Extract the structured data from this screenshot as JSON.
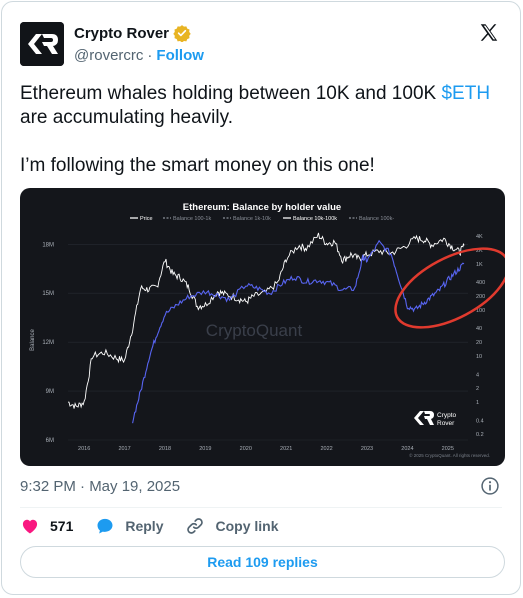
{
  "author": {
    "name": "Crypto Rover",
    "handle": "@rovercrc",
    "separator": "·",
    "follow_label": "Follow"
  },
  "tweet": {
    "text_before_cashtag": "Ethereum whales holding between 10K and 100K ",
    "cashtag": "$ETH",
    "text_after_cashtag": "are accumulating heavily.",
    "paragraph2": "I’m following the smart money on this one!"
  },
  "media": {
    "brand_logo_text": "Crypto\nRover",
    "watermark": "CryptoQuant"
  },
  "meta": {
    "timestamp": "9:32 PM · May 19, 2025"
  },
  "actions": {
    "like_count": "571",
    "reply_label": "Reply",
    "copy_link_label": "Copy link"
  },
  "read_replies_label": "Read 109 replies",
  "colors": {
    "accent": "#1d9bf0",
    "like": "#f91880",
    "chart_bg": "#14161b",
    "price_line": "#ffffff",
    "balance_line": "#5865f2",
    "highlight_circle": "#e03a2e"
  },
  "chart_data": {
    "type": "line",
    "title": "Ethereum: Balance by holder value",
    "legend": [
      {
        "name": "Price",
        "style": "solid",
        "color": "#ffffff"
      },
      {
        "name": "Balance 100-1k",
        "style": "dashed",
        "color": "#8a8f98"
      },
      {
        "name": "Balance 1k-10k",
        "style": "dashed",
        "color": "#8a8f98"
      },
      {
        "name": "Balance 10k-100k",
        "style": "solid",
        "color": "#ffffff"
      },
      {
        "name": "Balance 100k-",
        "style": "dashed",
        "color": "#8a8f98"
      }
    ],
    "legend_position": "top",
    "ylabel": "Balance",
    "left_ticks": [
      "18M",
      "15M",
      "12M",
      "9M",
      "6M"
    ],
    "right_ticks": [
      "4K",
      "2K",
      "1K",
      "400",
      "200",
      "100",
      "40",
      "20",
      "10",
      "4",
      "2",
      "1",
      "0.4",
      "0.2"
    ],
    "right_scale": "log",
    "x_ticks": [
      "2016",
      "2017",
      "2018",
      "2019",
      "2020",
      "2021",
      "2022",
      "2023",
      "2024",
      "2025"
    ],
    "x_range": [
      2015.6,
      2025.5
    ],
    "y_range_left": [
      6,
      19
    ],
    "footnote": "© 2025 CryptoQuant. All rights reserved.",
    "series": [
      {
        "name": "Price",
        "axis": "right",
        "x": [
          2015.6,
          2015.8,
          2016.0,
          2016.2,
          2016.5,
          2016.8,
          2017.0,
          2017.2,
          2017.4,
          2017.6,
          2017.8,
          2018.0,
          2018.2,
          2018.4,
          2018.6,
          2018.8,
          2019.0,
          2019.3,
          2019.5,
          2019.8,
          2020.0,
          2020.2,
          2020.5,
          2020.8,
          2021.0,
          2021.3,
          2021.5,
          2021.8,
          2022.0,
          2022.2,
          2022.4,
          2022.6,
          2022.8,
          2023.0,
          2023.3,
          2023.6,
          2023.9,
          2024.2,
          2024.4,
          2024.6,
          2024.9,
          2025.1,
          2025.3,
          2025.4
        ],
        "values": [
          1,
          0.8,
          1,
          10,
          12,
          9,
          8,
          40,
          300,
          280,
          320,
          1200,
          600,
          500,
          300,
          120,
          130,
          250,
          220,
          180,
          150,
          200,
          240,
          400,
          1300,
          2500,
          2200,
          4200,
          2800,
          3000,
          1200,
          1600,
          1300,
          1600,
          1900,
          1700,
          2300,
          3600,
          3400,
          2600,
          3500,
          2400,
          1800,
          2500
        ]
      },
      {
        "name": "Balance 10k-100k",
        "axis": "left",
        "x": [
          2017.2,
          2017.4,
          2017.6,
          2017.8,
          2018.0,
          2018.3,
          2018.6,
          2019.0,
          2019.3,
          2019.6,
          2020.0,
          2020.3,
          2020.6,
          2020.9,
          2021.2,
          2021.5,
          2021.8,
          2022.1,
          2022.4,
          2022.7,
          2022.9,
          2023.0,
          2023.3,
          2023.6,
          2023.8,
          2024.0,
          2024.2,
          2024.4,
          2024.6,
          2024.8,
          2025.0,
          2025.2,
          2025.4
        ],
        "values": [
          7.2,
          9.0,
          11.0,
          12.5,
          13.7,
          14.3,
          14.8,
          15.1,
          14.9,
          14.6,
          15.5,
          15.3,
          15.0,
          15.6,
          16.0,
          15.7,
          15.8,
          15.6,
          15.2,
          15.3,
          17.2,
          17.0,
          18.1,
          17.4,
          15.8,
          14.2,
          14.0,
          14.4,
          14.8,
          15.2,
          15.8,
          16.3,
          16.8
        ]
      }
    ],
    "annotations": [
      {
        "type": "ellipse",
        "color": "#e03a2e",
        "around": "Balance 10k-100k 2023.9–2025.5 rise"
      }
    ]
  }
}
